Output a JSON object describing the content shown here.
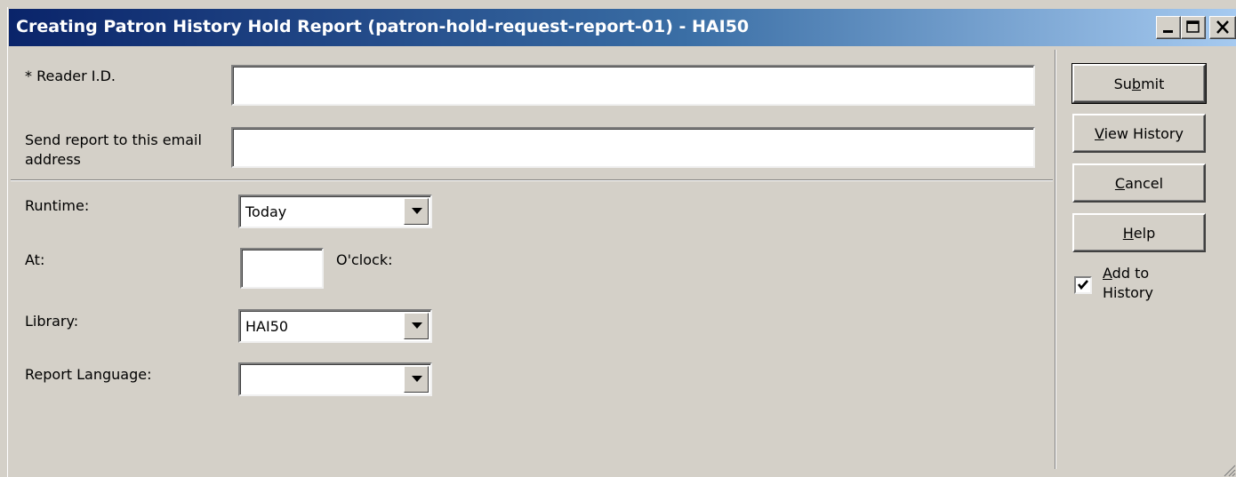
{
  "window": {
    "title": "Creating Patron History Hold Report (patron-hold-request-report-01) - HAI50",
    "controls": [
      "minimize-icon",
      "maximize-icon",
      "close-icon"
    ]
  },
  "form": {
    "reader_id_label": "* Reader I.D.",
    "reader_id_value": "",
    "email_label_line1": "Send report to this email",
    "email_label_line2": "address",
    "email_value": "",
    "runtime_label": "Runtime:",
    "runtime_value": "Today",
    "at_label": "At:",
    "at_value": "",
    "oclock_label": "O'clock:",
    "library_label": "Library:",
    "library_value": "HAI50",
    "report_language_label": "Report Language:",
    "report_language_value": ""
  },
  "actions": {
    "submit": {
      "pre": "Su",
      "mn": "b",
      "post": "mit"
    },
    "view_history": {
      "pre": "",
      "mn": "V",
      "post": "iew History"
    },
    "cancel": {
      "pre": "",
      "mn": "C",
      "post": "ancel"
    },
    "help": {
      "pre": "",
      "mn": "H",
      "post": "elp"
    },
    "add_to_history": {
      "mn": "A",
      "line1_rest": "dd to",
      "line2": "History",
      "checked": true
    }
  },
  "colors": {
    "face": "#d4d0c8",
    "title_start": "#0a246a",
    "title_end": "#a6caf0"
  }
}
